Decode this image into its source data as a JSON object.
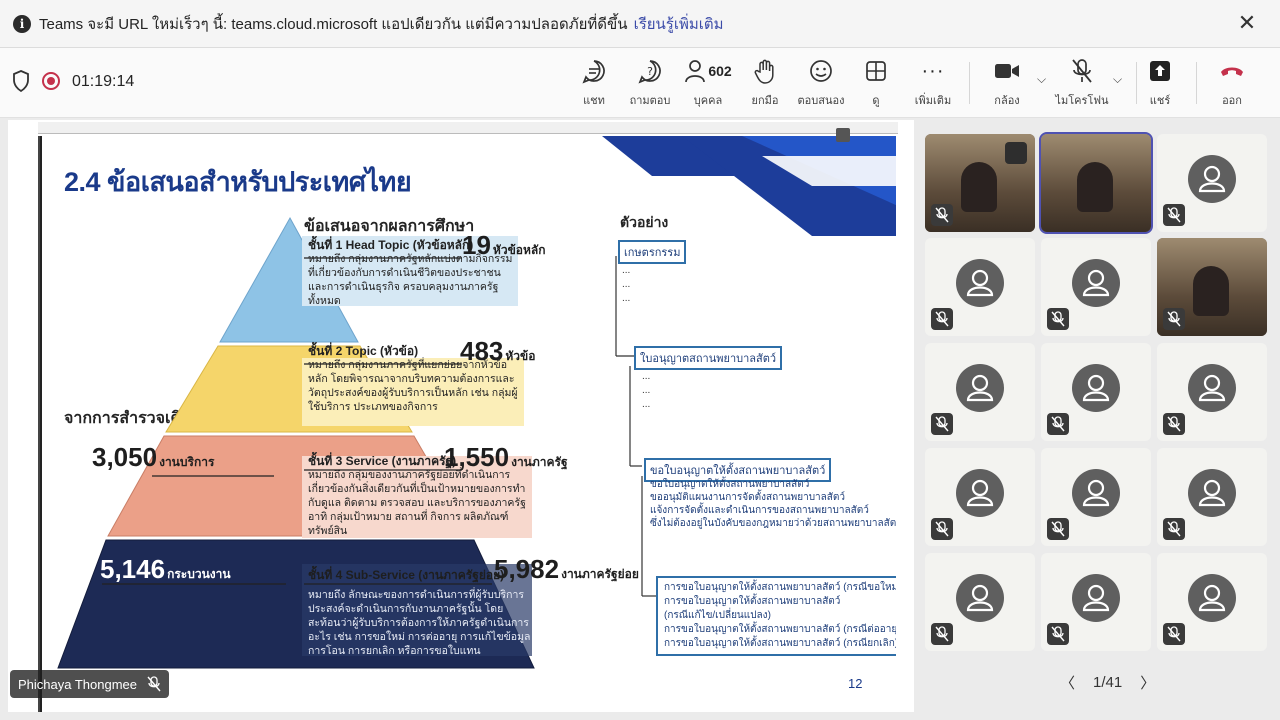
{
  "banner": {
    "message": "Teams จะมี URL ใหม่เร็วๆ นี้: teams.cloud.microsoft แอปเดียวกัน แต่มีความปลอดภัยที่ดีขึ้น",
    "link": "เรียนรู้เพิ่มเติม",
    "close": "✕"
  },
  "toolbar": {
    "timer": "01:19:14",
    "chat": "แชท",
    "qa": "ถามตอบ",
    "people_label": "บุคคล",
    "people_count": "602",
    "raise": "ยกมือ",
    "react": "ตอบสนอง",
    "view": "ดู",
    "more": "เพิ่มเติม",
    "camera": "กล้อง",
    "mic": "ไมโครโฟน",
    "share": "แชร์",
    "leave": "ออก"
  },
  "slide": {
    "title": "2.4 ข้อเสนอสำหรับประเทศไทย",
    "pyramid_heading": "ข้อเสนอจากผลการศึกษา",
    "from_old": "จากการสำรวจเดิม",
    "example_title": "ตัวอย่าง",
    "page": "12",
    "levels": [
      {
        "header": "ชั้นที่ 1 Head Topic (หัวข้อหลัก)",
        "count": "19",
        "unit": "หัวข้อหลัก",
        "text": "หมายถึง กลุ่มงานภาครัฐหลักแบ่งตามกิจกรรมที่เกี่ยวข้องกับการดำเนินชีวิตของประชาชนและการดำเนินธุรกิจ ครอบคลุมงานภาครัฐทั้งหมด"
      },
      {
        "header": "ชั้นที่ 2 Topic (หัวข้อ)",
        "count": "483",
        "unit": "หัวข้อ",
        "text": "หมายถึง กลุ่มงานภาครัฐที่แยกย่อยจากหัวข้อหลัก โดยพิจารณาจากบริบทความต้องการและวัตถุประสงค์ของผู้รับบริการเป็นหลัก เช่น กลุ่มผู้ใช้บริการ ประเภทของกิจการ"
      },
      {
        "header": "ชั้นที่ 3 Service (งานภาครัฐ)",
        "count": "1,550",
        "unit": "งานภาครัฐ",
        "text": "หมายถึง กลุ่มของงานภาครัฐย่อยที่ดำเนินการเกี่ยวข้องกันสิ่งเดียวกันที่เป็นเป้าหมายของการทำกับดูแล ติดตาม ตรวจสอบ และบริการของภาครัฐ อาทิ กลุ่มเป้าหมาย สถานที่ กิจการ ผลิตภัณฑ์ ทรัพย์สิน"
      },
      {
        "header": "ชั้นที่ 4 Sub-Service (งานภาครัฐย่อย)",
        "count": "5,982",
        "unit": "งานภาครัฐย่อย",
        "text": "หมายถึง ลักษณะของการดำเนินการที่ผู้รับบริการประสงค์จะดำเนินการกับงานภาครัฐนั้น โดยสะท้อนว่าผู้รับบริการต้องการให้ภาครัฐดำเนินการอะไร เช่น การขอใหม่ การต่ออายุ การแก้ไขข้อมูล การโอน การยกเลิก หรือการขอใบแทน"
      }
    ],
    "old": [
      {
        "count": "3,050",
        "unit": "งานบริการ"
      },
      {
        "count": "5,146",
        "unit": "กระบวนงาน"
      }
    ],
    "tree": {
      "level1": "เกษตรกรรม",
      "level2": "ใบอนุญาตสถานพยาบาลสัตว์",
      "level3": "ขอใบอนุญาตให้ตั้งสถานพยาบาลสัตว์",
      "level3_items": [
        "ขอใบอนุญาตให้ตั้งสถานพยาบาลสัตว์",
        "ขออนุมัติแผนงานการจัดตั้งสถานพยาบาลสัตว์",
        "แจ้งการจัดตั้งและดำเนินการของสถานพยาบาลสัตว์",
        "ซึ่งไม่ต้องอยู่ในบังคับของกฎหมายว่าด้วยสถานพยาบาลสัตว์"
      ],
      "level4_items": [
        "การขอใบอนุญาตให้ตั้งสถานพยาบาลสัตว์ (กรณีขอใหม่)",
        "การขอใบอนุญาตให้ตั้งสถานพยาบาลสัตว์",
        "(กรณีแก้ไข/เปลี่ยนแปลง)",
        "การขอใบอนุญาตให้ตั้งสถานพยาบาลสัตว์ (กรณีต่ออายุ)",
        "การขอใบอนุญาตให้ตั้งสถานพยาบาลสัตว์ (กรณียกเลิก)"
      ],
      "dots": "..."
    }
  },
  "presenter": "Phichaya Thongmee",
  "pager": {
    "text": "1/41",
    "prev": "〈",
    "next": "〉"
  },
  "colors": {
    "accent": "#1a3a8a",
    "leave": "#c4314b",
    "level1": "#8ec3e6",
    "level2": "#f5d56a",
    "level3": "#eba088",
    "level4": "#1d2a55"
  }
}
